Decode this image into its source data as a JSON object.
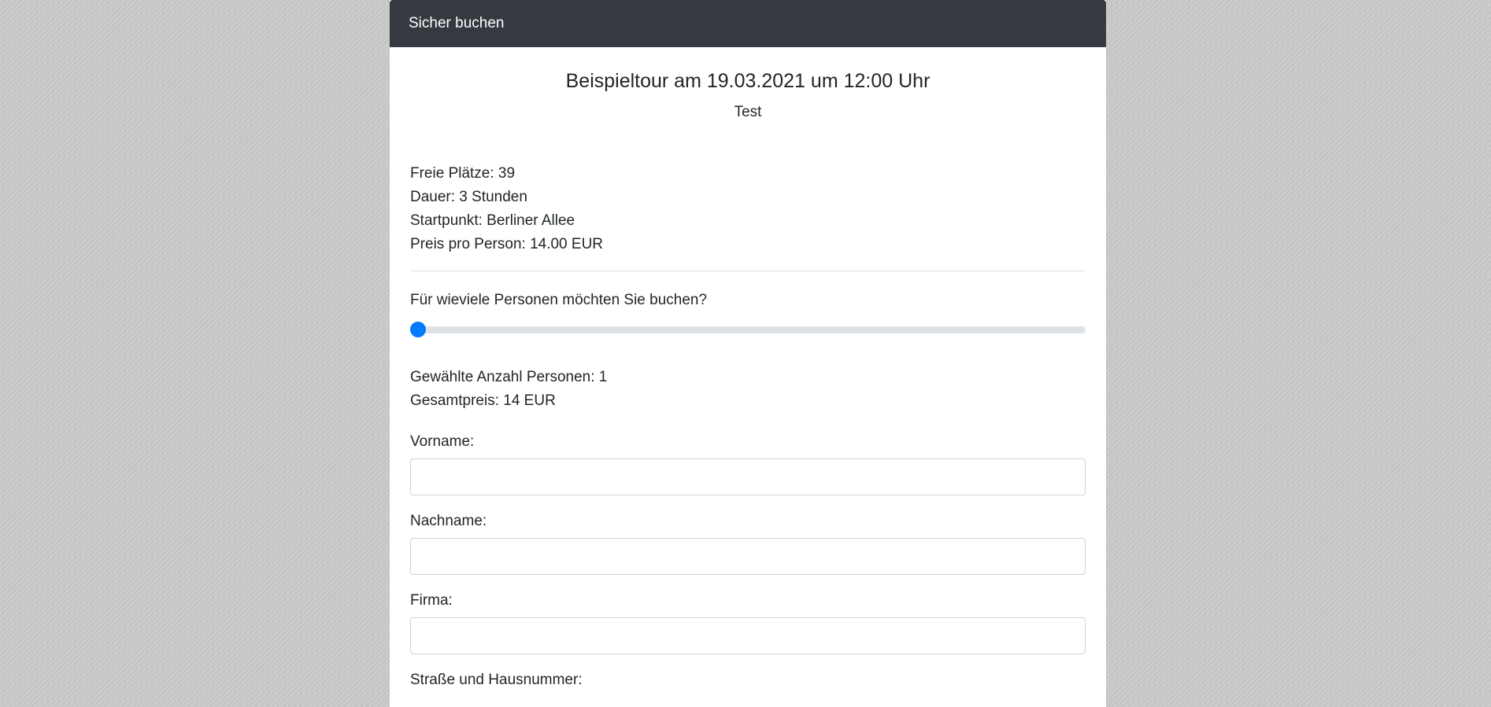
{
  "header": {
    "title": "Sicher buchen"
  },
  "tour": {
    "title": "Beispieltour am 19.03.2021 um 12:00 Uhr",
    "subtitle": "Test"
  },
  "info": {
    "free_seats": "Freie Plätze: 39",
    "duration": "Dauer: 3 Stunden",
    "start_point": "Startpunkt: Berliner Allee",
    "price_per_person": "Preis pro Person: 14.00 EUR"
  },
  "booking": {
    "question": "Für wieviele Personen möchten Sie buchen?",
    "slider": {
      "min": 1,
      "max": 39,
      "value": 1
    },
    "selected_count": "Gewählte Anzahl Personen: 1",
    "total_price": "Gesamtpreis: 14 EUR"
  },
  "form": {
    "first_name_label": "Vorname:",
    "first_name_value": "",
    "last_name_label": "Nachname:",
    "last_name_value": "",
    "company_label": "Firma:",
    "company_value": "",
    "street_label": "Straße und Hausnummer:"
  },
  "colors": {
    "header_bg": "#343a40",
    "accent": "#007bff",
    "track": "#dee2e6"
  }
}
